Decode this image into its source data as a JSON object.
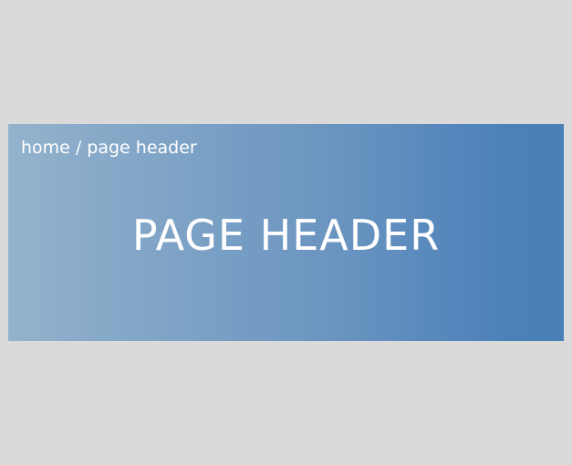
{
  "breadcrumb": {
    "home": "home",
    "separator": "/",
    "current": "page header"
  },
  "header": {
    "title": "PAGE HEADER"
  },
  "colors": {
    "background": "#dadada",
    "gradient_start": "#93b2cc",
    "gradient_end": "#4a7fb8",
    "text": "#ffffff"
  }
}
